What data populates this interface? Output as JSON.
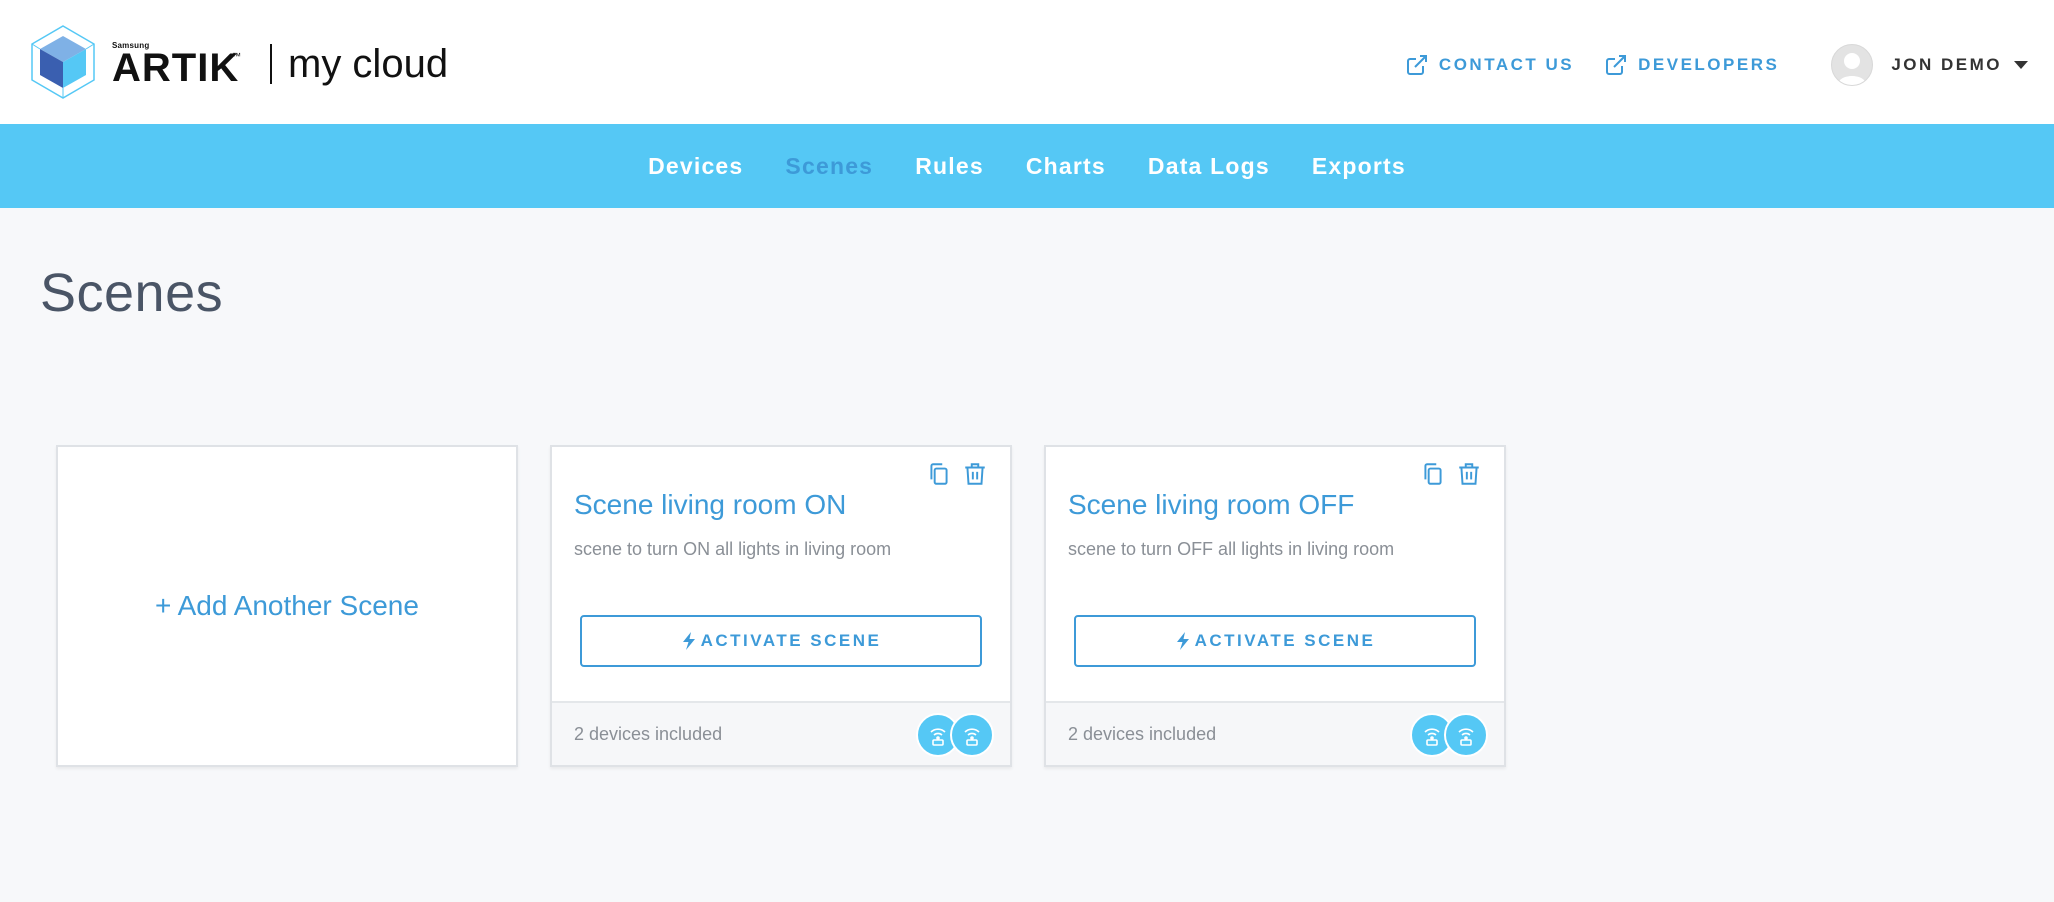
{
  "header": {
    "brand": {
      "samsung": "Samsung",
      "artik": "ARTIK",
      "tm": "™",
      "product": "my cloud"
    },
    "links": [
      {
        "label": "CONTACT US"
      },
      {
        "label": "DEVELOPERS"
      }
    ],
    "user": {
      "name": "JON DEMO"
    }
  },
  "nav": {
    "items": [
      {
        "label": "Devices"
      },
      {
        "label": "Scenes"
      },
      {
        "label": "Rules"
      },
      {
        "label": "Charts"
      },
      {
        "label": "Data Logs"
      },
      {
        "label": "Exports"
      }
    ],
    "active": "Scenes"
  },
  "page": {
    "title": "Scenes"
  },
  "add_card": {
    "label": "+ Add Another Scene"
  },
  "scenes": [
    {
      "title": "Scene living room ON",
      "description": "scene to turn ON all lights in living room",
      "action_label": "ACTIVATE SCENE",
      "devices_label": "2 devices included",
      "device_icons": [
        "smart-light-icon",
        "smart-light-icon"
      ]
    },
    {
      "title": "Scene living room OFF",
      "description": "scene to turn OFF all lights in living room",
      "action_label": "ACTIVATE SCENE",
      "devices_label": "2 devices included",
      "device_icons": [
        "smart-light-icon",
        "smart-light-icon"
      ]
    }
  ],
  "colors": {
    "accent": "#3d9ad8",
    "nav_bg": "#55c8f5",
    "page_bg": "#f7f8fa",
    "muted_text": "#8a8f96"
  }
}
